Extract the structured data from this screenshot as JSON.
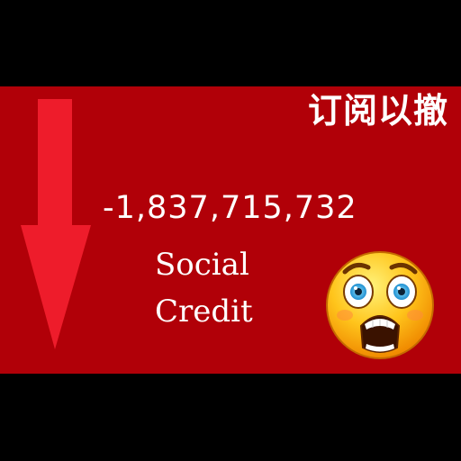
{
  "headline": "订阅以撤",
  "amount": "-1,837,715,732",
  "caption": {
    "line1": "Social",
    "line2": "Credit"
  },
  "icons": {
    "arrow": "down-arrow-icon",
    "face": "shocked-face-emoji"
  },
  "colors": {
    "background": "#000000",
    "banner": "#b10008",
    "arrow": "#ee1c2b",
    "text": "#ffffff",
    "face": "#ffb400"
  }
}
